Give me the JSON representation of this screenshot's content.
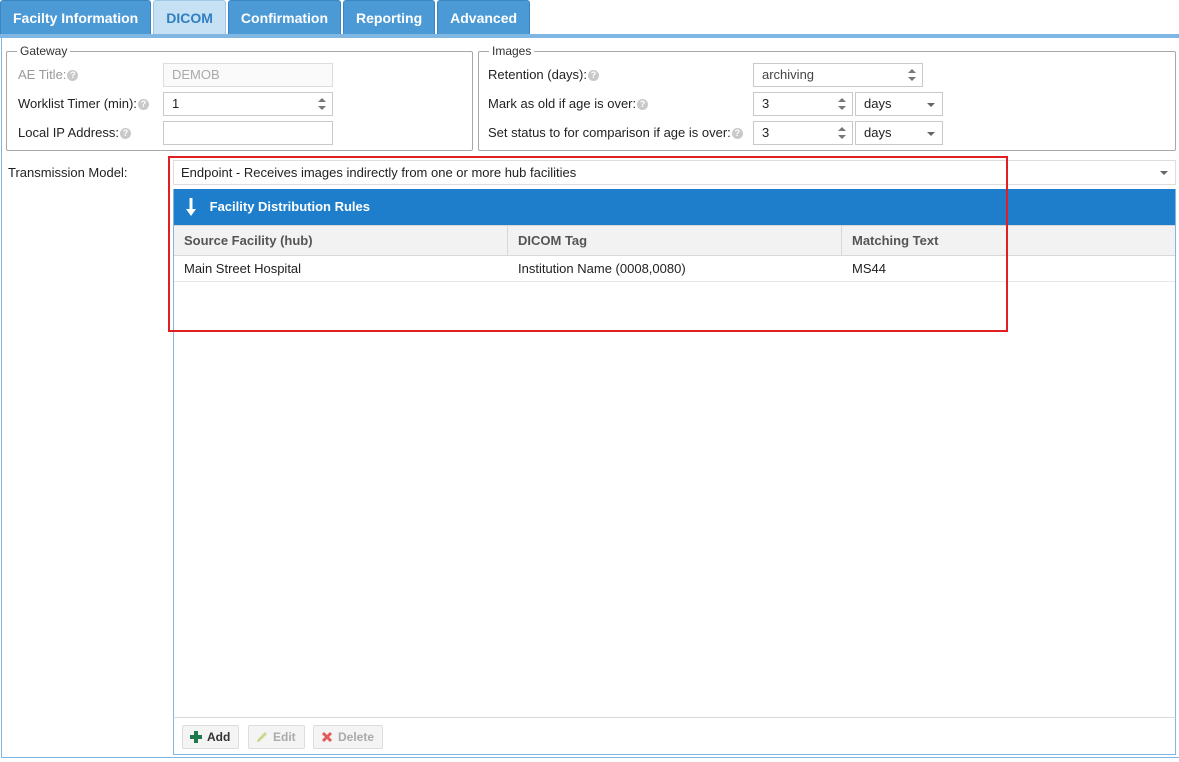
{
  "tabs": [
    {
      "label": "Facilty Information",
      "active": false
    },
    {
      "label": "DICOM",
      "active": true
    },
    {
      "label": "Confirmation",
      "active": false
    },
    {
      "label": "Reporting",
      "active": false
    },
    {
      "label": "Advanced",
      "active": false
    }
  ],
  "gateway": {
    "legend": "Gateway",
    "ae_title_label": "AE Title:",
    "ae_title_value": "DEMOB",
    "worklist_timer_label": "Worklist Timer (min):",
    "worklist_timer_value": "1",
    "local_ip_label": "Local IP Address:",
    "local_ip_value": ""
  },
  "images": {
    "legend": "Images",
    "retention_label": "Retention (days):",
    "retention_value": "archiving",
    "mark_old_label": "Mark as old if age is over:",
    "mark_old_value": "3",
    "mark_old_unit": "days",
    "status_label": "Set status to for comparison if age is over:",
    "status_value": "3",
    "status_unit": "days"
  },
  "transmission": {
    "label": "Transmission Model:",
    "value": "Endpoint - Receives images indirectly from one or more hub facilities"
  },
  "grid": {
    "title": "Facility Distribution Rules",
    "columns": [
      "Source Facility (hub)",
      "DICOM Tag",
      "Matching Text"
    ],
    "rows": [
      [
        "Main Street Hospital",
        "Institution Name (0008,0080)",
        "MS44"
      ]
    ]
  },
  "toolbar": {
    "add_label": "Add",
    "edit_label": "Edit",
    "delete_label": "Delete"
  },
  "colors": {
    "tab_bg": "#4b9ad6",
    "tab_active_bg": "#c6e0f4",
    "grid_header_bg": "#1f7ecb",
    "highlight": "#e02020"
  }
}
